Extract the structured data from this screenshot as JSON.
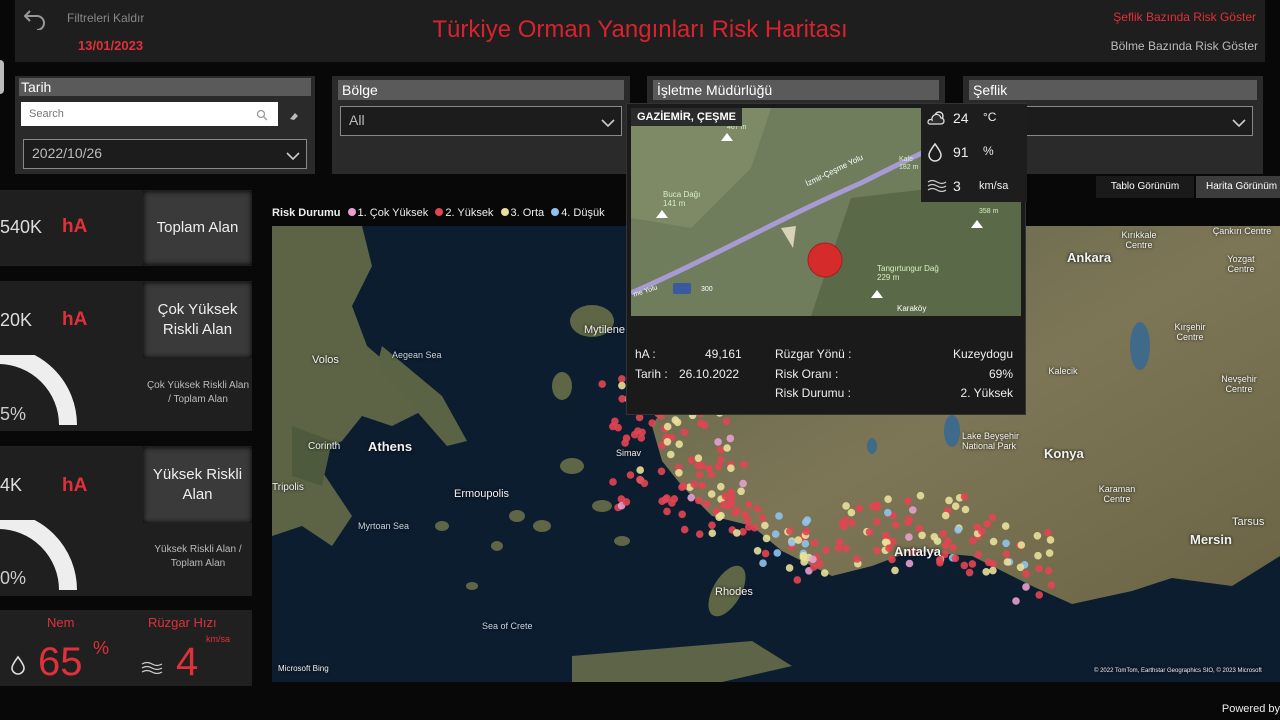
{
  "header": {
    "title": "Türkiye Orman Yangınları Risk Haritası",
    "clear_filters": "Filtreleri Kaldır",
    "date": "13/01/2023",
    "btn_sefilk": "Şeflik Bazında Risk Göster",
    "btn_bolme": "Bölme Bazında Risk Göster"
  },
  "filters": {
    "tarih": {
      "label": "Tarih",
      "search_placeholder": "Search",
      "value": "2022/10/26"
    },
    "bolge": {
      "label": "Bölge",
      "value": "All"
    },
    "isletme": {
      "label": "İşletme Müdürlüğü"
    },
    "seflik": {
      "label": "Şeflik"
    }
  },
  "kpis": {
    "toplam": {
      "value": "540K",
      "unit": "hA",
      "button": "Toplam Alan"
    },
    "cok_yuksek": {
      "value": "20K",
      "unit": "hA",
      "button": "Çok Yüksek Riskli Alan",
      "percent": "5%",
      "percent_value": 0.05,
      "caption": "Çok Yüksek Riskli Alan / Toplam Alan"
    },
    "yuksek": {
      "value": "4K",
      "unit": "hA",
      "button": "Yüksek Riskli Alan",
      "percent": "0%",
      "percent_value": 0.0,
      "caption": "Yüksek Riskli Alan / Toplam Alan"
    }
  },
  "stats": {
    "nem_label": "Nem",
    "nem_value": "65",
    "nem_unit": "%",
    "ruzgar_label": "Rüzgar Hızı",
    "ruzgar_value": "4",
    "ruzgar_unit": "km/sa"
  },
  "legend": {
    "title": "Risk Durumu",
    "items": [
      {
        "label": "1. Çok Yüksek",
        "color": "#e8a0d0"
      },
      {
        "label": "2. Yüksek",
        "color": "#e24552"
      },
      {
        "label": "3. Orta",
        "color": "#e8e09a"
      },
      {
        "label": "4. Düşük",
        "color": "#8fc3ef"
      }
    ]
  },
  "view": {
    "table": "Tablo Görünüm",
    "map": "Harita Görünüm"
  },
  "map_labels": {
    "ankara": "Ankara",
    "konya": "Konya",
    "athens": "Athens",
    "antalya": "Antalya",
    "mersin": "Mersin",
    "aegean": "Aegean Sea",
    "myrtoan": "Myrtoan Sea",
    "crete": "Sea of Crete",
    "volos": "Volos",
    "mytilene": "Mytilene",
    "rhodes": "Rhodes",
    "ermoupolis": "Ermoupolis",
    "corinth": "Corinth",
    "bing": "Microsoft Bing",
    "copyright": "© 2022 TomTom, Earthstar Geographics SIO, © 2023 Microsoft",
    "karaman": "Karaman Centre",
    "kirsehir": "Kırşehir Centre",
    "nevsehir": "Nevşehir Centre",
    "yozgat": "Yozgat Centre",
    "tarsus": "Tarsus",
    "lake": "Lake Beyşehir National Park",
    "simav": "Simav",
    "kirikkale": "Kırıkkale Centre",
    "kalecik": "Kalecik",
    "cankiri": "Çankırı Centre",
    "tripolis": "Tripolis"
  },
  "tooltip": {
    "title": "GAZİEMİR, ÇEŞME",
    "temp": "24",
    "temp_unit": "°C",
    "humidity": "91",
    "humidity_unit": "%",
    "wind": "3",
    "wind_unit": "km/sa",
    "ha_label": "hA :",
    "ha_value": "49,161",
    "tarih_label": "Tarih :",
    "tarih_value": "26.10.2022",
    "yon_label": "Rüzgar Yönü :",
    "yon_value": "Kuzeydogu",
    "oran_label": "Risk Oranı :",
    "oran_value": "69%",
    "durum_label": "Risk Durumu :",
    "durum_value": "2. Yüksek",
    "inner": {
      "buca": "Buca Dağı",
      "buca_h": "141 m",
      "tangir": "Tangırtungur Dağ",
      "tangir_h": "229 m",
      "karakuy": "Karaköy",
      "road": "İzmir-Çeşme Yolu",
      "shield": "300",
      "yolu": "me Yolu",
      "h1": "467 m",
      "h2": "182 m",
      "h3": "358 m",
      "kale": "Kale"
    }
  },
  "powered": "Powered by"
}
